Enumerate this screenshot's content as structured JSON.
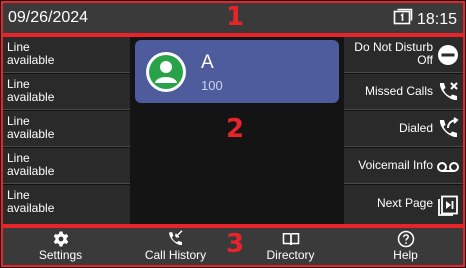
{
  "status_bar": {
    "date": "09/26/2024",
    "time": "18:15",
    "line_icon": "line-one-icon"
  },
  "line_keys": [
    {
      "label_line1": "Line",
      "label_line2": "available"
    },
    {
      "label_line1": "Line",
      "label_line2": "available"
    },
    {
      "label_line1": "Line",
      "label_line2": "available"
    },
    {
      "label_line1": "Line",
      "label_line2": "available"
    },
    {
      "label_line1": "Line",
      "label_line2": "available"
    }
  ],
  "contact": {
    "name": "A",
    "number": "100",
    "avatar_icon": "person-icon",
    "avatar_color": "#2aa24a",
    "card_color": "#4e5b9c"
  },
  "softkeys": [
    {
      "label_line1": "Do Not Disturb",
      "label_line2": "Off",
      "icon": "do-not-disturb-icon"
    },
    {
      "label_line1": "Missed Calls",
      "label_line2": "",
      "icon": "missed-calls-icon"
    },
    {
      "label_line1": "Dialed",
      "label_line2": "",
      "icon": "dialed-calls-icon"
    },
    {
      "label_line1": "Voicemail Info",
      "label_line2": "",
      "icon": "voicemail-icon"
    },
    {
      "label_line1": "Next Page",
      "label_line2": "",
      "icon": "next-page-icon"
    }
  ],
  "bottom_nav": [
    {
      "label": "Settings",
      "icon": "gear-icon"
    },
    {
      "label": "Call History",
      "icon": "call-history-icon"
    },
    {
      "label": "Directory",
      "icon": "book-icon"
    },
    {
      "label": "Help",
      "icon": "help-icon"
    }
  ],
  "annotations": {
    "region_1": "1",
    "region_2": "2",
    "region_3": "3",
    "color": "#e8242b"
  }
}
